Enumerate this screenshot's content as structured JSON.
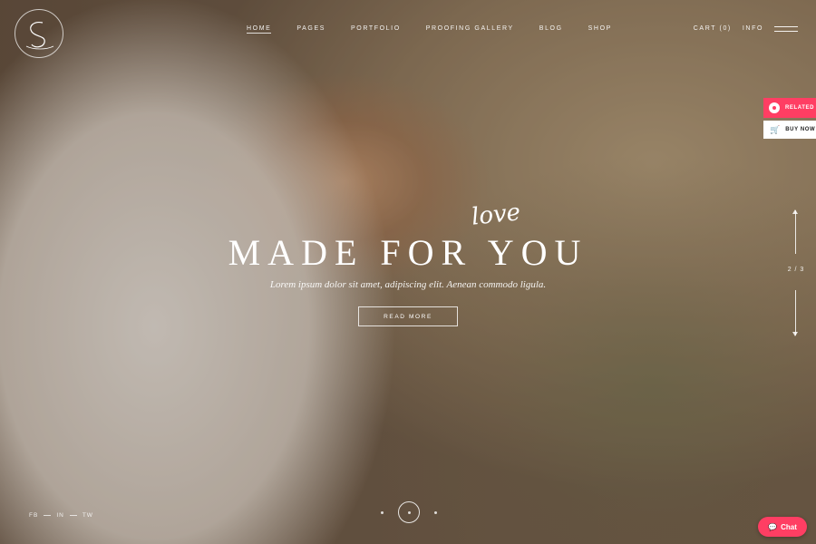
{
  "nav": {
    "items": [
      {
        "label": "HOME"
      },
      {
        "label": "PAGES"
      },
      {
        "label": "PORTFOLIO"
      },
      {
        "label": "PROOFING GALLERY"
      },
      {
        "label": "BLOG"
      },
      {
        "label": "SHOP"
      }
    ]
  },
  "header": {
    "cart": "CART (0)",
    "info": "INFO"
  },
  "side": {
    "related": "RELATED",
    "buynow": "BUY NOW",
    "slide_counter": "2 / 3"
  },
  "hero": {
    "script_word": "love",
    "title": "MADE FOR YOU",
    "subtitle": "Lorem ipsum dolor sit amet, adipiscing elit. Aenean commodo ligula.",
    "button": "READ MORE"
  },
  "social": [
    "FB",
    "IN",
    "TW"
  ],
  "chat": {
    "label": "Chat"
  },
  "colors": {
    "accent": "#ff3e63",
    "text": "#ffffff"
  },
  "icons": {
    "logo": "logo-mark",
    "related": "record-icon",
    "buynow": "cart-icon",
    "chat": "chat-bubble-icon"
  }
}
